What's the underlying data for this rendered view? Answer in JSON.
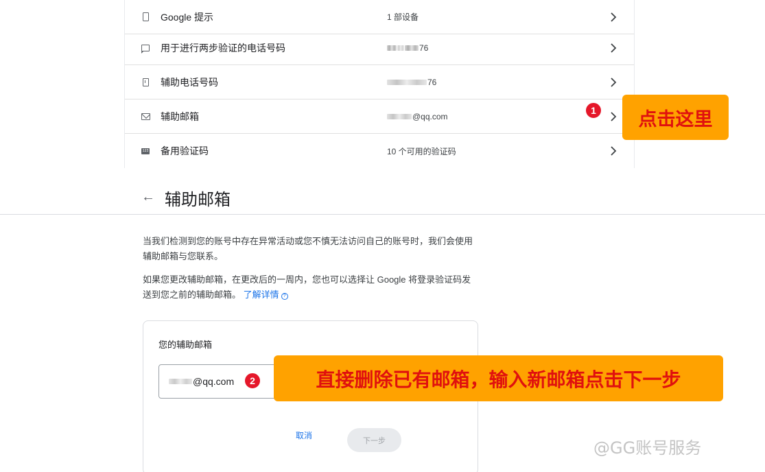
{
  "security_list": {
    "rows": [
      {
        "icon": "phone-icon",
        "label": "Google 提示",
        "value": "1 部设备"
      },
      {
        "icon": "message-icon",
        "label": "用于进行两步验证的电话号码",
        "value_suffix": "76"
      },
      {
        "icon": "phone-icon",
        "label": "辅助电话号码",
        "value_suffix": "76"
      },
      {
        "icon": "mail-icon",
        "label": "辅助邮箱",
        "value_suffix": "@qq.com"
      },
      {
        "icon": "code-icon",
        "label": "备用验证码",
        "value": "10 个可用的验证码"
      }
    ]
  },
  "annotations": {
    "step1_number": "1",
    "step1_text": "点击这里",
    "step2_number": "2",
    "step2_text": "直接删除已有邮箱，输入新邮箱点击下一步"
  },
  "detail": {
    "back_icon": "arrow-back-icon",
    "title": "辅助邮箱",
    "paragraph1": "当我们检测到您的账号中存在异常活动或您不慎无法访问自己的账号时，我们会使用辅助邮箱与您联系。",
    "paragraph2": "如果您更改辅助邮箱，在更改后的一周内，您也可以选择让 Google 将登录验证码发送到您之前的辅助邮箱。",
    "learn_more": "了解详情",
    "help_icon": "help-icon"
  },
  "form": {
    "label": "您的辅助邮箱",
    "email_suffix": "@qq.com",
    "cancel_label": "取消",
    "next_label": "下一步"
  },
  "watermark": "@GG账号服务",
  "colors": {
    "accent_blue": "#1a73e8",
    "callout_bg": "#ffa200",
    "callout_text": "#e0110e",
    "badge_red": "#e5172a"
  }
}
